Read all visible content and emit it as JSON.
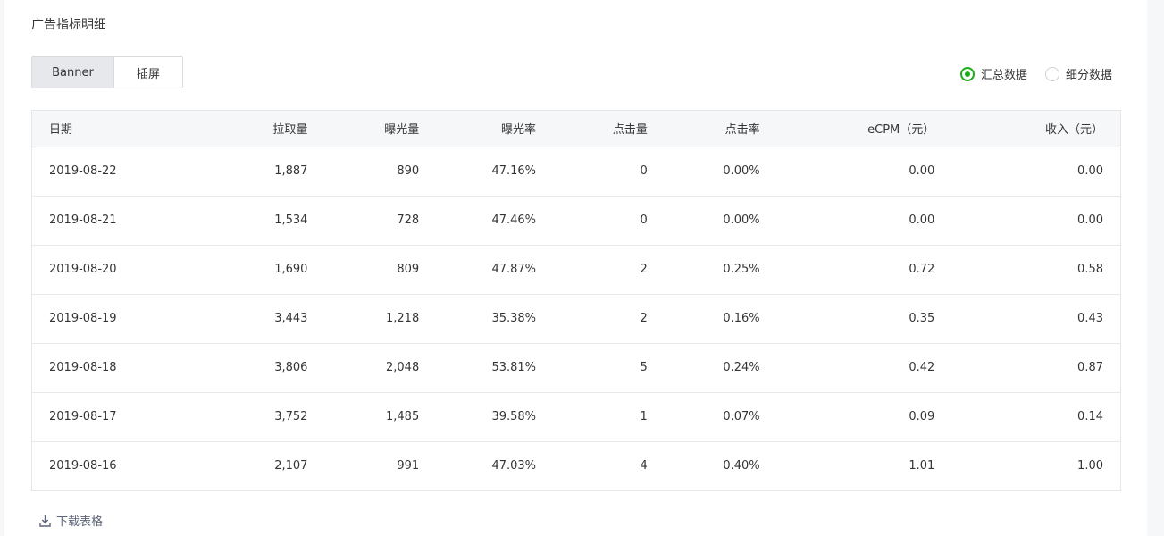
{
  "page": {
    "title": "广告指标明细"
  },
  "tabs": [
    {
      "label": "Banner",
      "active": true
    },
    {
      "label": "插屏",
      "active": false
    }
  ],
  "view_mode": {
    "options": [
      {
        "label": "汇总数据",
        "checked": true
      },
      {
        "label": "细分数据",
        "checked": false
      }
    ],
    "accent_color": "#1aad19"
  },
  "table": {
    "headers": [
      "日期",
      "拉取量",
      "曝光量",
      "曝光率",
      "点击量",
      "点击率",
      "eCPM（元）",
      "收入（元）"
    ],
    "rows": [
      [
        "2019-08-22",
        "1,887",
        "890",
        "47.16%",
        "0",
        "0.00%",
        "0.00",
        "0.00"
      ],
      [
        "2019-08-21",
        "1,534",
        "728",
        "47.46%",
        "0",
        "0.00%",
        "0.00",
        "0.00"
      ],
      [
        "2019-08-20",
        "1,690",
        "809",
        "47.87%",
        "2",
        "0.25%",
        "0.72",
        "0.58"
      ],
      [
        "2019-08-19",
        "3,443",
        "1,218",
        "35.38%",
        "2",
        "0.16%",
        "0.35",
        "0.43"
      ],
      [
        "2019-08-18",
        "3,806",
        "2,048",
        "53.81%",
        "5",
        "0.24%",
        "0.42",
        "0.87"
      ],
      [
        "2019-08-17",
        "3,752",
        "1,485",
        "39.58%",
        "1",
        "0.07%",
        "0.09",
        "0.14"
      ],
      [
        "2019-08-16",
        "2,107",
        "991",
        "47.03%",
        "4",
        "0.40%",
        "1.01",
        "1.00"
      ]
    ]
  },
  "download": {
    "label": "下载表格",
    "icon": "download-icon"
  }
}
